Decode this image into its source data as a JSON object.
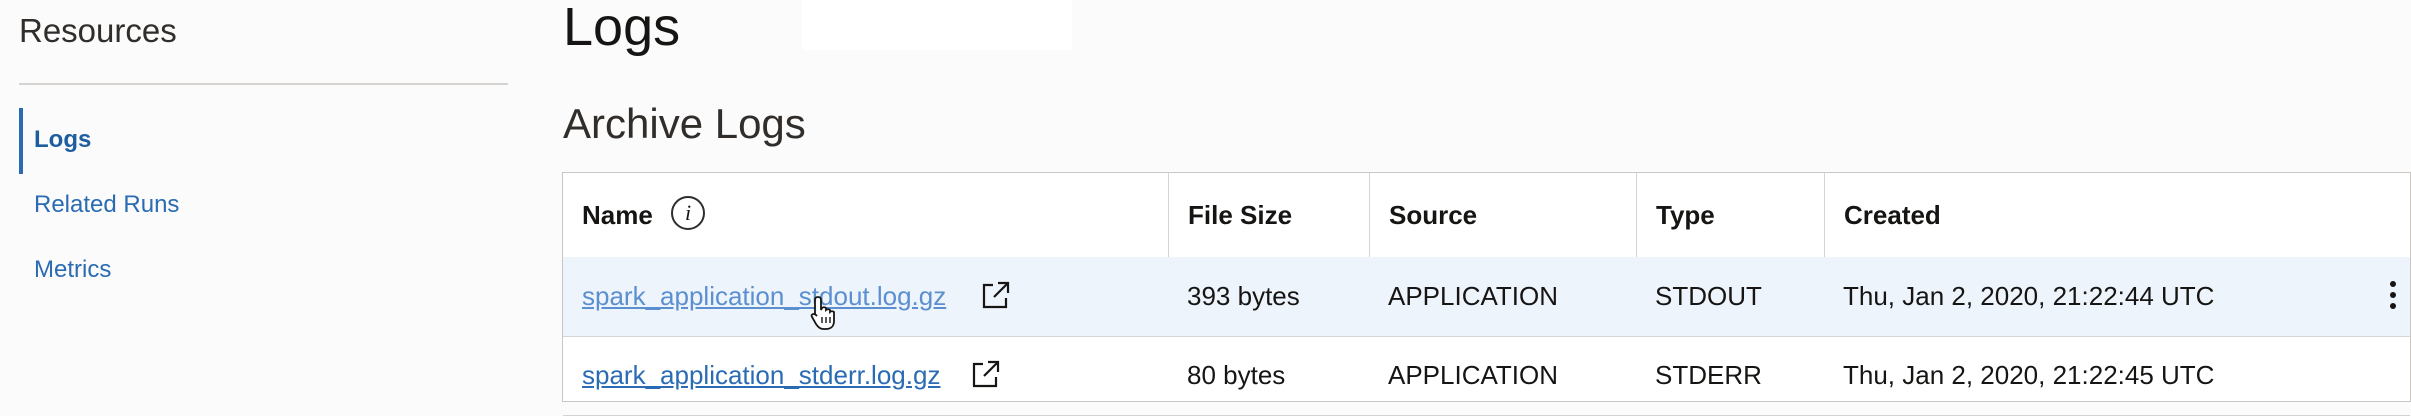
{
  "sidebar": {
    "title": "Resources",
    "items": [
      {
        "label": "Logs",
        "active": true
      },
      {
        "label": "Related Runs",
        "active": false
      },
      {
        "label": "Metrics",
        "active": false
      }
    ]
  },
  "main": {
    "page_title": "Logs",
    "section_title": "Archive Logs"
  },
  "table": {
    "columns": [
      "Name",
      "File Size",
      "Source",
      "Type",
      "Created"
    ],
    "rows": [
      {
        "name": "spark_application_stdout.log.gz",
        "file_size": "393 bytes",
        "source": "APPLICATION",
        "type": "STDOUT",
        "created": "Thu, Jan 2, 2020, 21:22:44 UTC"
      },
      {
        "name": "spark_application_stderr.log.gz",
        "file_size": "80 bytes",
        "source": "APPLICATION",
        "type": "STDERR",
        "created": "Thu, Jan 2, 2020, 21:22:45 UTC"
      }
    ]
  },
  "colors": {
    "accent": "#2a6bb3",
    "hover_row": "#eef4fb",
    "border": "#c9c6c3"
  },
  "icons": {
    "info": "info-icon",
    "external": "external-link-icon",
    "actions": "kebab-menu-icon",
    "cursor": "hand-cursor-icon"
  }
}
